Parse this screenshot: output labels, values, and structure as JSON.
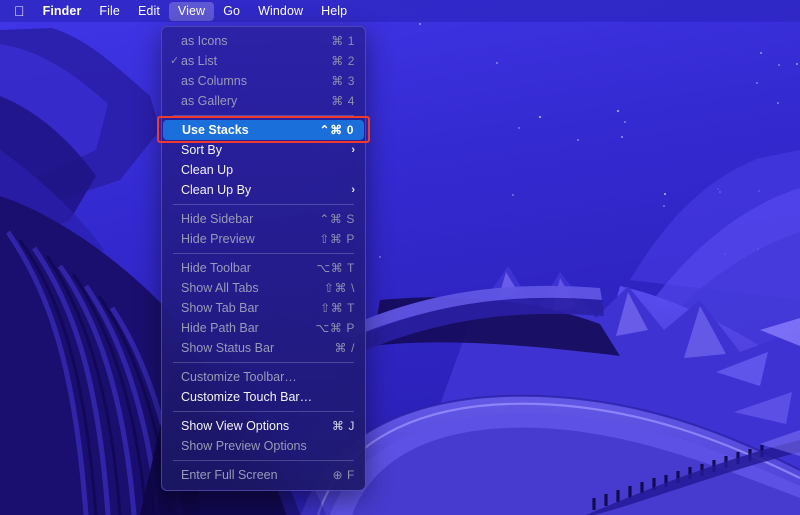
{
  "menubar": {
    "apple_icon": "apple-logo",
    "items": [
      {
        "label": "Finder",
        "bold": true,
        "active": false
      },
      {
        "label": "File",
        "bold": false,
        "active": false
      },
      {
        "label": "Edit",
        "bold": false,
        "active": false
      },
      {
        "label": "View",
        "bold": false,
        "active": true
      },
      {
        "label": "Go",
        "bold": false,
        "active": false
      },
      {
        "label": "Window",
        "bold": false,
        "active": false
      },
      {
        "label": "Help",
        "bold": false,
        "active": false
      }
    ]
  },
  "view_menu": {
    "title": "View",
    "highlight_color": "#1a6fdb",
    "annotation_color": "#ef3b2d",
    "groups": [
      {
        "items": [
          {
            "label": "as Icons",
            "shortcut": "⌘ 1",
            "checked": false,
            "disabled": true,
            "submenu": false,
            "highlighted": false
          },
          {
            "label": "as List",
            "shortcut": "⌘ 2",
            "checked": true,
            "disabled": true,
            "submenu": false,
            "highlighted": false
          },
          {
            "label": "as Columns",
            "shortcut": "⌘ 3",
            "checked": false,
            "disabled": true,
            "submenu": false,
            "highlighted": false
          },
          {
            "label": "as Gallery",
            "shortcut": "⌘ 4",
            "checked": false,
            "disabled": true,
            "submenu": false,
            "highlighted": false
          }
        ]
      },
      {
        "items": [
          {
            "label": "Use Stacks",
            "shortcut": "⌃⌘ 0",
            "checked": false,
            "disabled": false,
            "submenu": false,
            "highlighted": true
          },
          {
            "label": "Sort By",
            "shortcut": "",
            "checked": false,
            "disabled": false,
            "submenu": true,
            "highlighted": false
          },
          {
            "label": "Clean Up",
            "shortcut": "",
            "checked": false,
            "disabled": false,
            "submenu": false,
            "highlighted": false
          },
          {
            "label": "Clean Up By",
            "shortcut": "",
            "checked": false,
            "disabled": false,
            "submenu": true,
            "highlighted": false
          }
        ]
      },
      {
        "items": [
          {
            "label": "Hide Sidebar",
            "shortcut": "⌃⌘ S",
            "checked": false,
            "disabled": true,
            "submenu": false,
            "highlighted": false
          },
          {
            "label": "Hide Preview",
            "shortcut": "⇧⌘ P",
            "checked": false,
            "disabled": true,
            "submenu": false,
            "highlighted": false
          }
        ]
      },
      {
        "items": [
          {
            "label": "Hide Toolbar",
            "shortcut": "⌥⌘ T",
            "checked": false,
            "disabled": true,
            "submenu": false,
            "highlighted": false
          },
          {
            "label": "Show All Tabs",
            "shortcut": "⇧⌘ \\",
            "checked": false,
            "disabled": true,
            "submenu": false,
            "highlighted": false
          },
          {
            "label": "Show Tab Bar",
            "shortcut": "⇧⌘ T",
            "checked": false,
            "disabled": true,
            "submenu": false,
            "highlighted": false
          },
          {
            "label": "Hide Path Bar",
            "shortcut": "⌥⌘ P",
            "checked": false,
            "disabled": true,
            "submenu": false,
            "highlighted": false
          },
          {
            "label": "Show Status Bar",
            "shortcut": "⌘ /",
            "checked": false,
            "disabled": true,
            "submenu": false,
            "highlighted": false
          }
        ]
      },
      {
        "items": [
          {
            "label": "Customize Toolbar…",
            "shortcut": "",
            "checked": false,
            "disabled": true,
            "submenu": false,
            "highlighted": false
          },
          {
            "label": "Customize Touch Bar…",
            "shortcut": "",
            "checked": false,
            "disabled": false,
            "submenu": false,
            "highlighted": false
          }
        ]
      },
      {
        "items": [
          {
            "label": "Show View Options",
            "shortcut": "⌘ J",
            "checked": false,
            "disabled": false,
            "submenu": false,
            "highlighted": false
          },
          {
            "label": "Show Preview Options",
            "shortcut": "",
            "checked": false,
            "disabled": true,
            "submenu": false,
            "highlighted": false
          }
        ]
      },
      {
        "items": [
          {
            "label": "Enter Full Screen",
            "shortcut": "⊕ F",
            "checked": false,
            "disabled": true,
            "submenu": false,
            "highlighted": false
          }
        ]
      }
    ]
  },
  "desktop": {
    "wallpaper_name": "mountain-road-night-wallpaper",
    "colors": {
      "sky_top": "#3b2fd6",
      "sky_bottom": "#2a22b8",
      "mountain_dark": "#1b0f6e",
      "mountain_mid": "#3a2fc8",
      "mountain_light": "#6f63f0",
      "road": "#5347dd",
      "shadow": "#120a45"
    }
  }
}
